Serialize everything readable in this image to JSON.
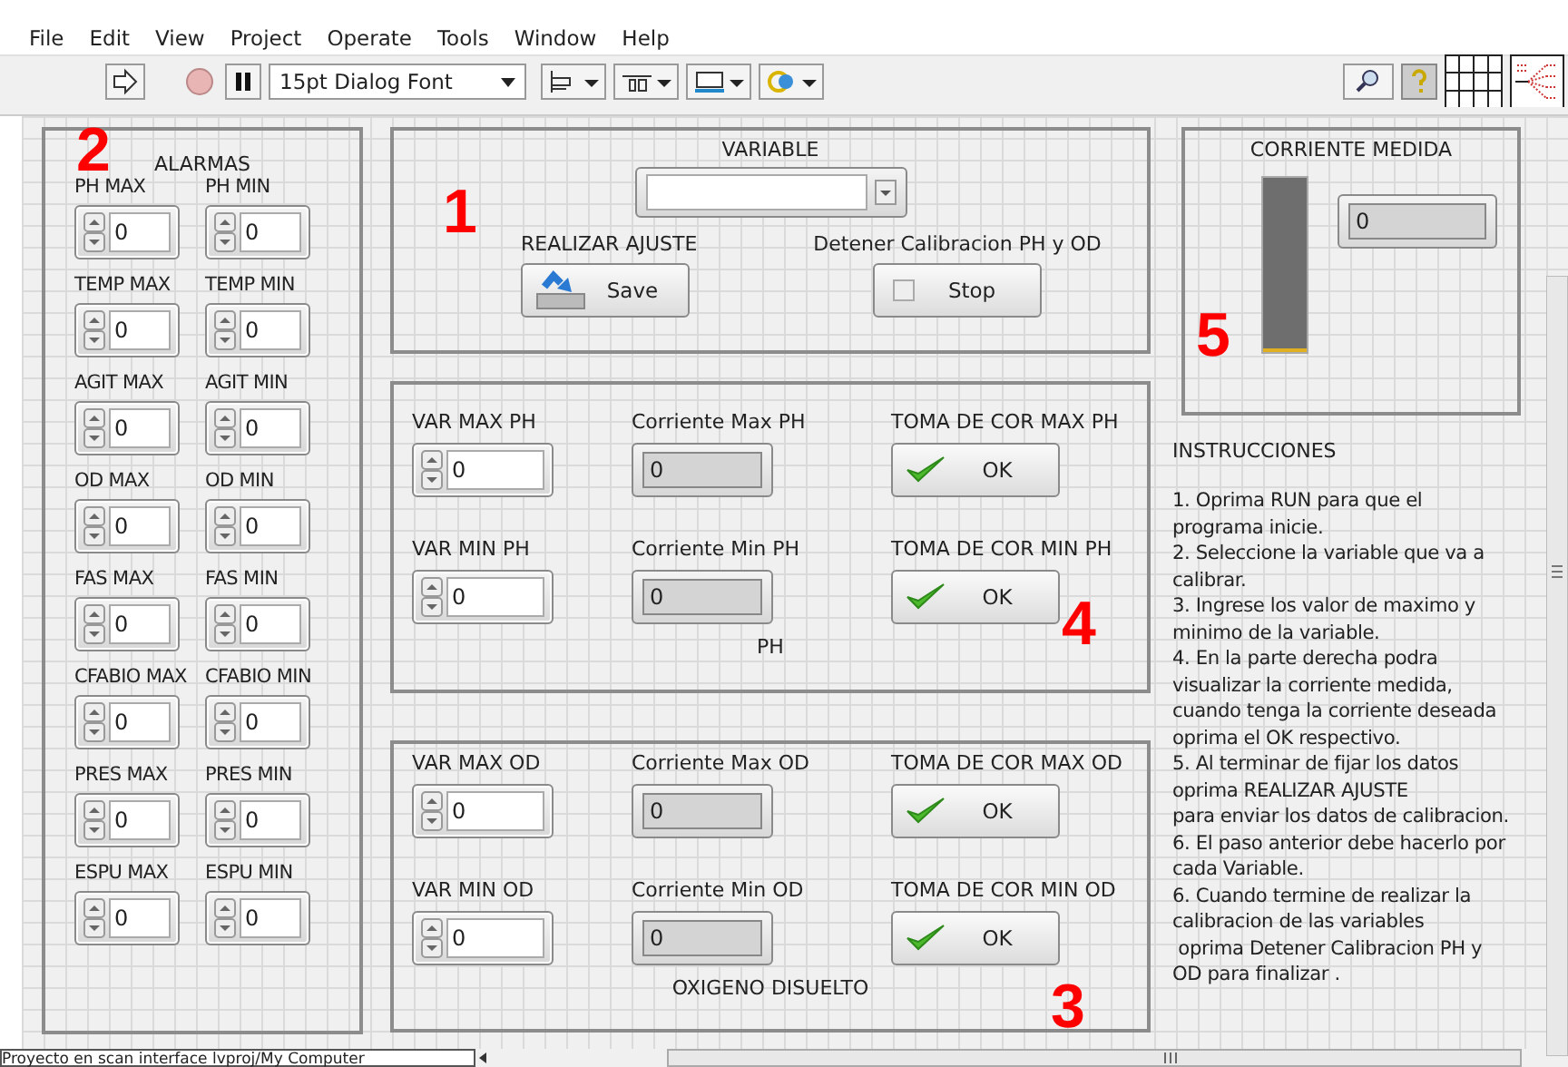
{
  "menu": [
    "File",
    "Edit",
    "View",
    "Project",
    "Operate",
    "Tools",
    "Window",
    "Help"
  ],
  "toolbar": {
    "font": "15pt Dialog Font"
  },
  "alarms": {
    "annotation": "2",
    "title": "ALARMAS",
    "controls": [
      {
        "label": "PH MAX",
        "value": "0"
      },
      {
        "label": "PH MIN",
        "value": "0"
      },
      {
        "label": "TEMP MAX",
        "value": "0"
      },
      {
        "label": "TEMP MIN",
        "value": "0"
      },
      {
        "label": "AGIT MAX",
        "value": "0"
      },
      {
        "label": "AGIT MIN",
        "value": "0"
      },
      {
        "label": "OD MAX",
        "value": "0"
      },
      {
        "label": "OD MIN",
        "value": "0"
      },
      {
        "label": "FAS MAX",
        "value": "0"
      },
      {
        "label": "FAS MIN",
        "value": "0"
      },
      {
        "label": "CFABIO MAX",
        "value": "0"
      },
      {
        "label": "CFABIO MIN",
        "value": "0"
      },
      {
        "label": "PRES MAX",
        "value": "0"
      },
      {
        "label": "PRES MIN",
        "value": "0"
      },
      {
        "label": "ESPU MAX",
        "value": "0"
      },
      {
        "label": "ESPU MIN",
        "value": "0"
      }
    ]
  },
  "setup": {
    "annotation": "1",
    "variable_label": "VARIABLE",
    "save_label": "REALIZAR AJUSTE",
    "save_button": "Save",
    "stop_label": "Detener Calibracion PH y OD",
    "stop_button": "Stop",
    "stop_checked": false
  },
  "sections": [
    {
      "annotation": "4",
      "title": "PH",
      "rows": [
        {
          "var_label": "VAR MAX PH",
          "var_value": "0",
          "current_label": "Corriente Max PH",
          "current_value": "0",
          "take_label": "TOMA DE  COR MAX PH",
          "button": "OK"
        },
        {
          "var_label": "VAR MIN PH",
          "var_value": "0",
          "current_label": "Corriente Min PH",
          "current_value": "0",
          "take_label": "TOMA DE  COR MIN PH",
          "button": "OK"
        }
      ]
    },
    {
      "annotation": "3",
      "title": "OXIGENO DISUELTO",
      "rows": [
        {
          "var_label": "VAR MAX OD",
          "var_value": "0",
          "current_label": "Corriente Max OD",
          "current_value": "0",
          "take_label": "TOMA DE  COR MAX OD",
          "button": "OK"
        },
        {
          "var_label": "VAR MIN OD",
          "var_value": "0",
          "current_label": "Corriente Min OD",
          "current_value": "0",
          "take_label": "TOMA DE  COR MIN OD",
          "button": "OK"
        }
      ]
    }
  ],
  "meter": {
    "annotation": "5",
    "title": "CORRIENTE MEDIDA",
    "level": 0,
    "value": "0"
  },
  "instructions": {
    "title": "INSTRUCCIONES",
    "steps": [
      "1. Oprima RUN para que el\nprograma inicie.",
      "2. Seleccione la variable que va a\ncalibrar.",
      "3. Ingrese los valor de maximo y\nminimo de la variable.",
      "4. En la parte derecha podra\nvisualizar la corriente medida,\ncuando tenga la corriente deseada\noprima el OK respectivo.",
      "5. Al terminar de fijar los datos\noprima REALIZAR AJUSTE\npara enviar los datos de calibracion.",
      "6. El paso anterior debe hacerlo por\ncada Variable.",
      "6. Cuando termine de realizar la\ncalibracion de las variables\n oprima Detener Calibracion PH y\nOD para finalizar ."
    ]
  },
  "status_bar": {
    "project": "Proyecto en scan interface lvproj/My Computer"
  }
}
